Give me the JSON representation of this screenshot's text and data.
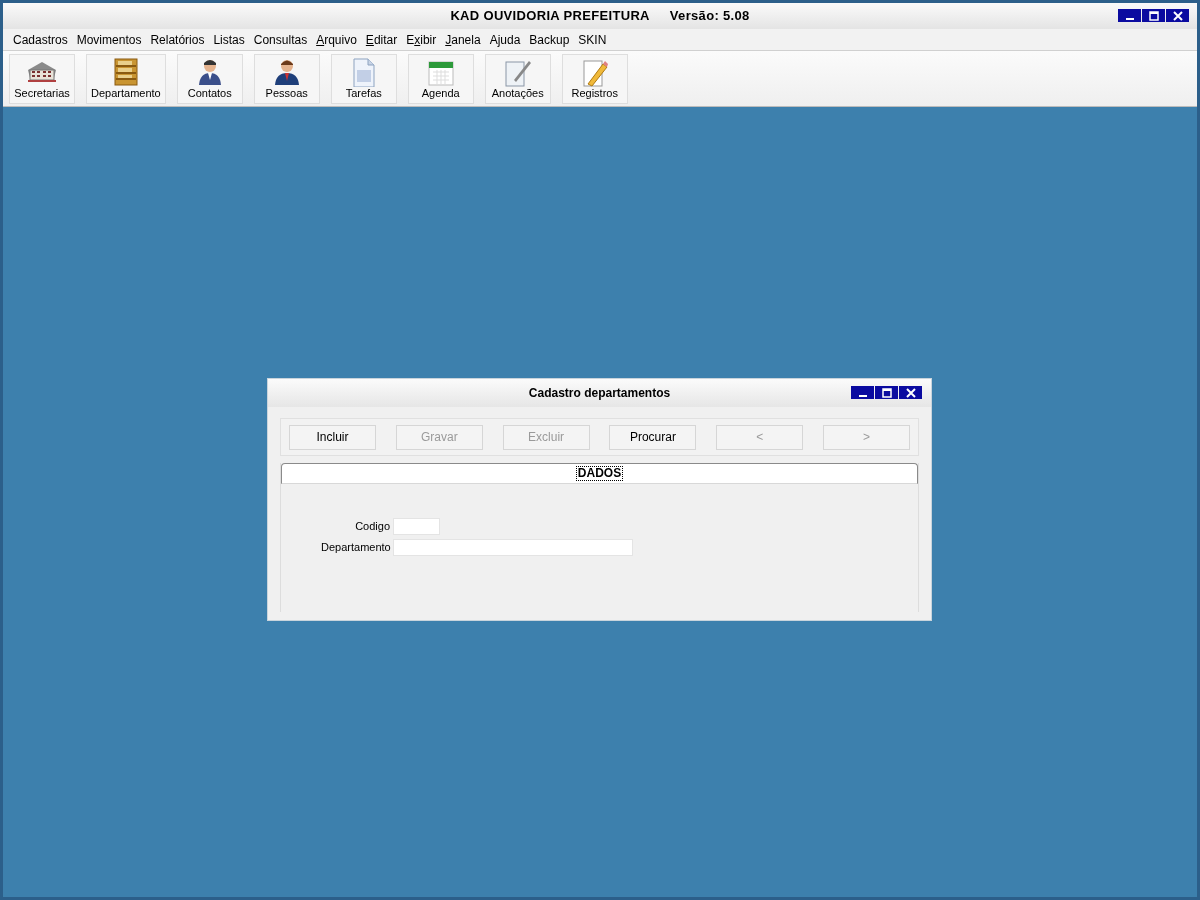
{
  "window": {
    "title": "KAD OUVIDORIA PREFEITURA",
    "version": "Versão: 5.08"
  },
  "menu": [
    {
      "label": "Cadastros"
    },
    {
      "label": "Movimentos"
    },
    {
      "label": "Relatórios"
    },
    {
      "label": "Listas"
    },
    {
      "label": "Consultas"
    },
    {
      "access_key": "A",
      "label_after": "rquivo"
    },
    {
      "access_key": "E",
      "label_after": "ditar"
    },
    {
      "label_before": "E",
      "access_key": "x",
      "label_after": "ibir"
    },
    {
      "access_key": "J",
      "label_after": "anela"
    },
    {
      "label": "Ajuda"
    },
    {
      "label": "Backup"
    },
    {
      "label": "SKIN"
    }
  ],
  "toolbar": [
    {
      "label": "Secretarias",
      "kind": "building"
    },
    {
      "label": "Departamento",
      "kind": "shelf"
    },
    {
      "label": "Contatos",
      "kind": "person"
    },
    {
      "label": "Pessoas",
      "kind": "person2"
    },
    {
      "label": "Tarefas",
      "kind": "document"
    },
    {
      "label": "Agenda",
      "kind": "calendar"
    },
    {
      "label": "Anotações",
      "kind": "notepad"
    },
    {
      "label": "Registros",
      "kind": "pencil"
    }
  ],
  "dialog": {
    "title": "Cadastro departamentos",
    "buttons": [
      {
        "label": "Incluir",
        "disabled": false
      },
      {
        "label": "Gravar",
        "disabled": true
      },
      {
        "label": "Excluir",
        "disabled": true
      },
      {
        "label": "Procurar",
        "disabled": false
      },
      {
        "label": "<",
        "disabled": true
      },
      {
        "label": ">",
        "disabled": true
      }
    ],
    "tab": {
      "label": "DADOS"
    },
    "fields": [
      {
        "label": "Codigo",
        "kind": "short"
      },
      {
        "label": "Departamento",
        "kind": "long"
      }
    ]
  }
}
